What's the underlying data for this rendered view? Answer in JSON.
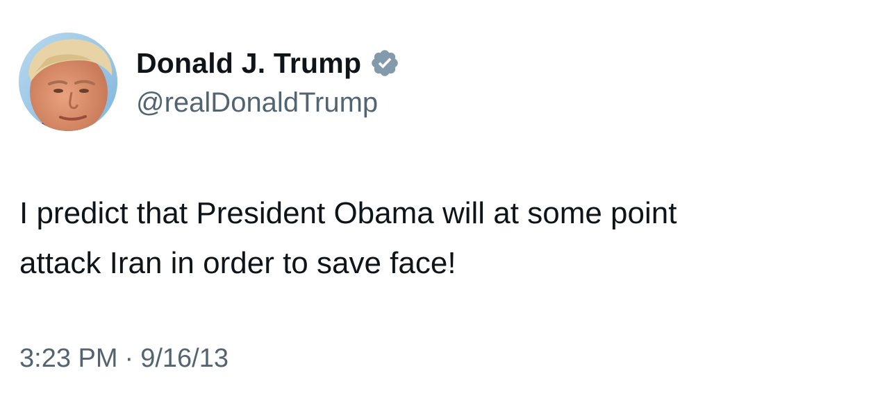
{
  "author": {
    "display_name": "Donald J. Trump",
    "handle": "@realDonaldTrump",
    "verified": true,
    "verified_badge_icon": "verified-badge-icon",
    "verified_color": "#829aab"
  },
  "tweet": {
    "lines": [
      "I predict that President Obama will at some point",
      "attack Iran in order to save face!"
    ]
  },
  "meta": {
    "time": "3:23 PM",
    "separator": "·",
    "date": "9/16/13"
  },
  "colors": {
    "text_primary": "#0f1419",
    "text_secondary": "#536471",
    "background": "#ffffff"
  }
}
